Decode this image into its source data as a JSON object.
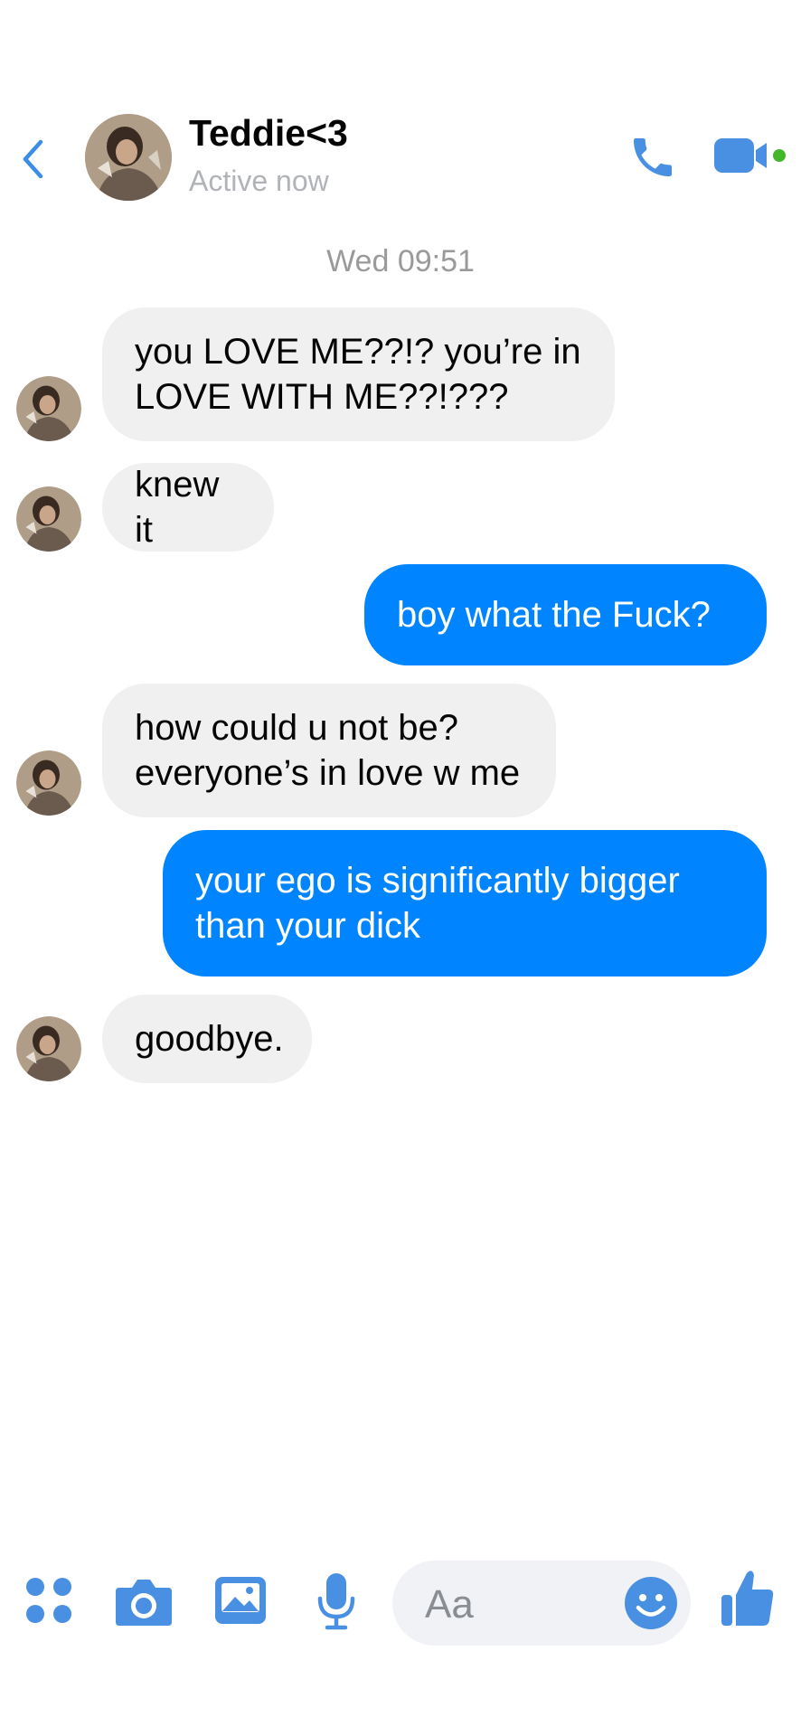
{
  "header": {
    "name": "Teddie<3",
    "status": "Active now"
  },
  "conversation": {
    "timestamp": "Wed 09:51",
    "messages": [
      {
        "sender": "them",
        "lines": [
          "you LOVE ME??!? you’re in",
          "LOVE WITH ME??!???"
        ]
      },
      {
        "sender": "them",
        "lines": [
          "knew it"
        ]
      },
      {
        "sender": "me",
        "lines": [
          "boy what the Fuck?"
        ]
      },
      {
        "sender": "them",
        "lines": [
          "how could u not be?",
          "everyone’s in love w me"
        ]
      },
      {
        "sender": "me",
        "lines": [
          "your ego is significantly bigger",
          "than your dick"
        ]
      },
      {
        "sender": "them",
        "lines": [
          "goodbye."
        ]
      }
    ]
  },
  "composer": {
    "placeholder": "Aa"
  },
  "colors": {
    "accent": "#0084ff",
    "icon_blue": "#4a90e2",
    "incoming_bubble": "#f0f0f0",
    "online_dot": "#42b72a"
  },
  "icons": {
    "back": "chevron-left-icon",
    "call": "phone-icon",
    "video": "video-camera-icon",
    "more": "four-dots-icon",
    "camera": "camera-icon",
    "gallery": "image-icon",
    "voice": "microphone-icon",
    "emoji": "smiley-icon",
    "like": "thumbs-up-icon"
  }
}
